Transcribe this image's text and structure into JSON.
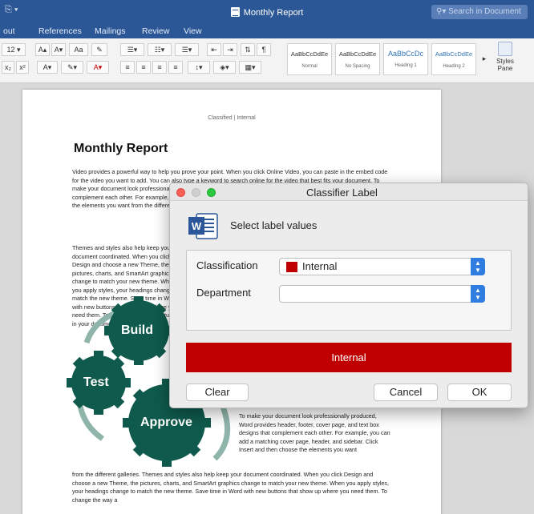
{
  "window": {
    "title": "Monthly Report",
    "search_placeholder": "Search in Document"
  },
  "ribbon": {
    "tabs": [
      "out",
      "References",
      "Mailings",
      "Review",
      "View"
    ],
    "font_size": "12",
    "styles": [
      {
        "sample": "AaBbCcDdEe",
        "name": "Normal"
      },
      {
        "sample": "AaBbCcDdEe",
        "name": "No Spacing"
      },
      {
        "sample": "AaBbCcDc",
        "name": "Heading 1"
      },
      {
        "sample": "AaBbCcDdEe",
        "name": "Heading 2"
      }
    ],
    "styles_pane": "Styles Pane"
  },
  "document": {
    "header": "Classified | Internal",
    "title": "Monthly Report",
    "para1": "Video provides a powerful way to help you prove your point. When you click Online Video, you can paste in the embed code for the video you want to add. You can also type a keyword to search online for the video that best fits your document. To make your document look professionally produced, Word provides header, footer, cover page, and text box designs that complement each other. For example, you can add a matching cover page, header, and sidebar. Click Insert and then choose the elements you want from the different galleries.",
    "para2": "Themes and styles also help keep your document coordinated. When you click Design and choose a new Theme, the pictures, charts, and SmartArt graphics change to match your new theme. When you apply styles, your headings change to match the new theme. Save time in Word with new buttons that show up where you need them. To change the way a picture fits in your document,",
    "para3": "To make your document look professionally produced, Word provides header, footer, cover page, and text box designs that complement each other. For example, you can add a matching cover page, header, and sidebar. Click Insert and then choose the elements you want",
    "para4": "from the different galleries. Themes and styles also help keep your document coordinated. When you click Design and choose a new Theme, the pictures, charts, and SmartArt graphics change to match your new theme. When you apply styles, your headings change to match the new theme. Save time in Word with new buttons that show up where you need them. To change the way a",
    "gears": [
      "Build",
      "Test",
      "Approve"
    ]
  },
  "dialog": {
    "title": "Classifier Label",
    "prompt": "Select label values",
    "classification_label": "Classification",
    "classification_value": "Internal",
    "classification_color": "#c00000",
    "department_label": "Department",
    "department_value": "",
    "banner_text": "Internal",
    "clear_label": "Clear",
    "cancel_label": "Cancel",
    "ok_label": "OK"
  }
}
